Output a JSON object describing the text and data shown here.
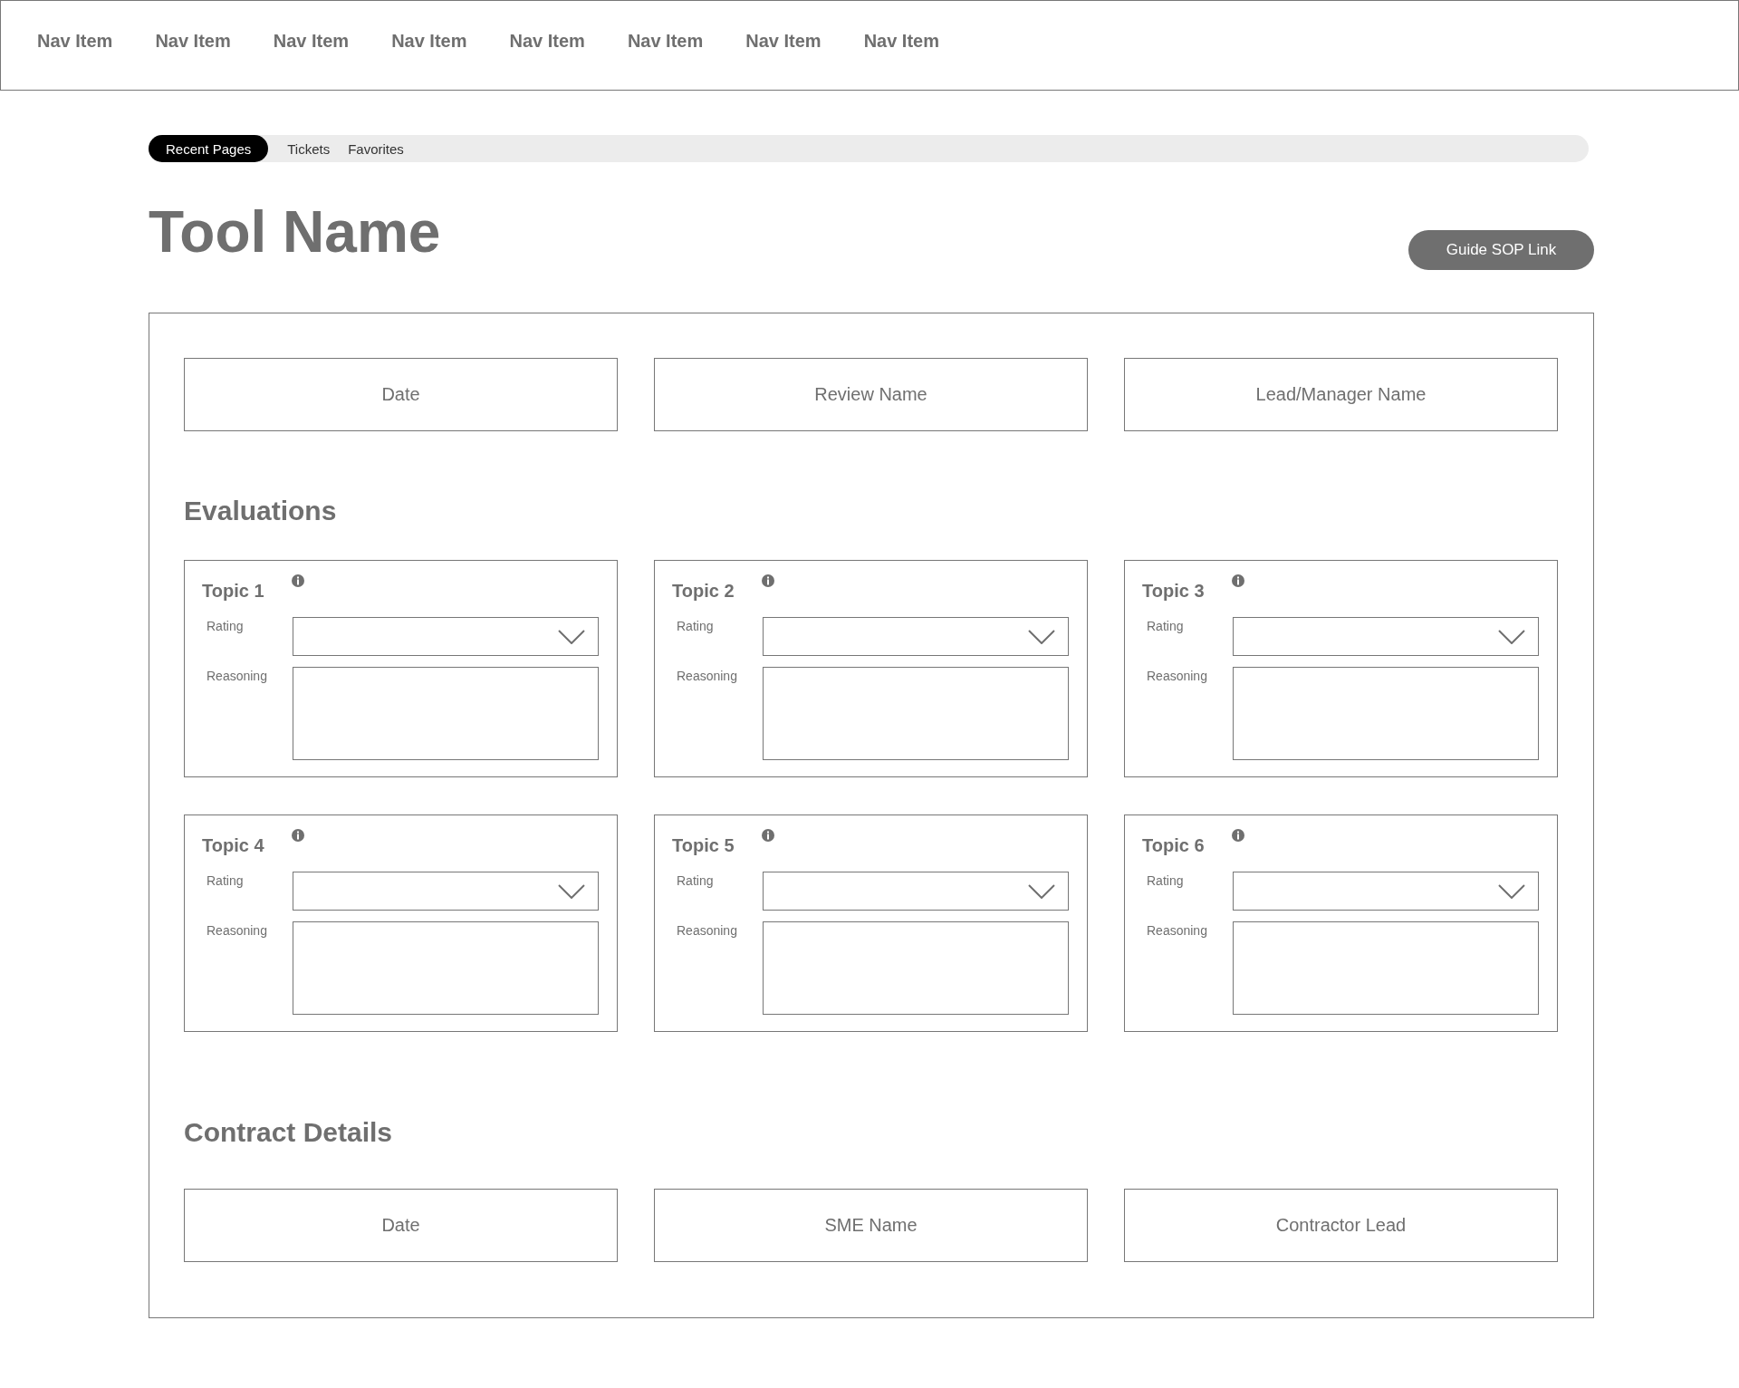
{
  "nav": {
    "items": [
      "Nav Item",
      "Nav Item",
      "Nav Item",
      "Nav Item",
      "Nav Item",
      "Nav Item",
      "Nav Item",
      "Nav Item"
    ]
  },
  "tabs": [
    {
      "label": "Recent Pages",
      "selected": true
    },
    {
      "label": "Tickets",
      "selected": false
    },
    {
      "label": "Favorites",
      "selected": false
    }
  ],
  "title": "Tool Name",
  "guide_button": "Guide SOP Link",
  "header_fields": [
    {
      "placeholder": "Date"
    },
    {
      "placeholder": "Review Name"
    },
    {
      "placeholder": "Lead/Manager Name"
    }
  ],
  "evaluations": {
    "heading": "Evaluations",
    "topics": [
      {
        "title": "Topic 1",
        "rating_label": "Rating",
        "reasoning_label": "Reasoning"
      },
      {
        "title": "Topic 2",
        "rating_label": "Rating",
        "reasoning_label": "Reasoning"
      },
      {
        "title": "Topic 3",
        "rating_label": "Rating",
        "reasoning_label": "Reasoning"
      },
      {
        "title": "Topic 4",
        "rating_label": "Rating",
        "reasoning_label": "Reasoning"
      },
      {
        "title": "Topic 5",
        "rating_label": "Rating",
        "reasoning_label": "Reasoning"
      },
      {
        "title": "Topic 6",
        "rating_label": "Rating",
        "reasoning_label": "Reasoning"
      }
    ]
  },
  "contract_details": {
    "heading": "Contract Details",
    "fields": [
      {
        "placeholder": "Date"
      },
      {
        "placeholder": "SME Name"
      },
      {
        "placeholder": "Contractor Lead"
      }
    ]
  }
}
